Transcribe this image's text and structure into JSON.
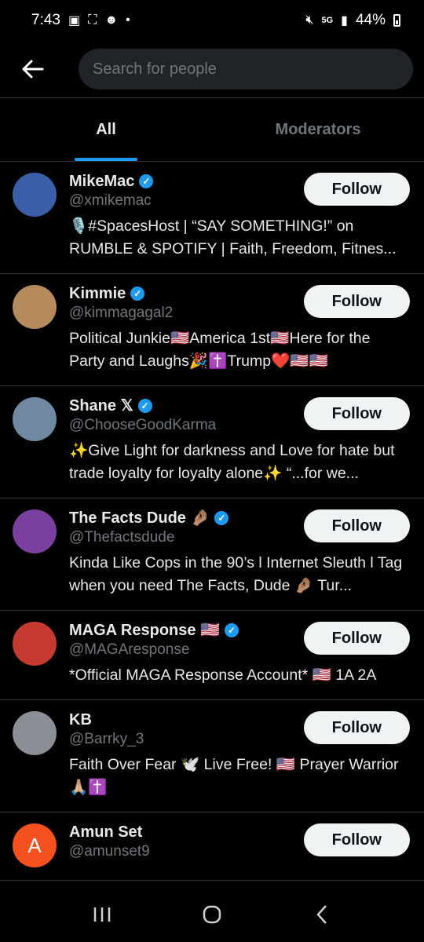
{
  "status_bar": {
    "time": "7:43",
    "battery": "44%",
    "icons": [
      "gallery-icon",
      "screenshot-icon",
      "reddit-icon",
      "dot-icon",
      "mute-icon",
      "5g-icon",
      "signal-icon",
      "battery-icon"
    ]
  },
  "header": {
    "search_placeholder": "Search for people",
    "back_icon": "arrow-left-icon"
  },
  "tabs": [
    {
      "label": "All",
      "active": true
    },
    {
      "label": "Moderators",
      "active": false
    }
  ],
  "users": [
    {
      "name": "MikeMac",
      "emoji": "",
      "verified": true,
      "handle": "@xmikemac",
      "bio": "🎙️#SpacesHost | “SAY SOMETHING!” on RUMBLE & SPOTIFY | Faith, Freedom, Fitnes...",
      "follow_label": "Follow",
      "avatar_color": "#3b5ea8",
      "avatar_letter": ""
    },
    {
      "name": "Kimmie",
      "emoji": "",
      "verified": true,
      "handle": "@kimmagagal2",
      "bio": "Political Junkie🇺🇸America 1st🇺🇸Here for the Party and Laughs🎉✝️Trump❤️🇺🇸🇺🇸",
      "follow_label": "Follow",
      "avatar_color": "#b58a5c",
      "avatar_letter": ""
    },
    {
      "name": "Shane 𝕏",
      "emoji": "",
      "verified": true,
      "handle": "@ChooseGoodKarma",
      "bio": "✨Give Light for darkness and Love for hate but trade loyalty for loyalty alone✨ “...for we...",
      "follow_label": "Follow",
      "avatar_color": "#6f8aa0",
      "avatar_letter": ""
    },
    {
      "name": "The Facts Dude 🤌🏽",
      "emoji": "",
      "verified": true,
      "handle": "@Thefactsdude",
      "bio": "Kinda Like Cops in the 90’s l Internet Sleuth l Tag when you need The Facts, Dude 🤌🏽 Tur...",
      "follow_label": "Follow",
      "avatar_color": "#7b3fa0",
      "avatar_letter": ""
    },
    {
      "name": "MAGA Response 🇺🇸",
      "emoji": "",
      "verified": true,
      "handle": "@MAGAresponse",
      "bio": "*Official MAGA Response Account* 🇺🇸 1A 2A",
      "follow_label": "Follow",
      "avatar_color": "#c43a2f",
      "avatar_letter": ""
    },
    {
      "name": "KB",
      "emoji": "",
      "verified": false,
      "handle": "@Barrky_3",
      "bio": "Faith Over Fear 🕊️ Live Free! 🇺🇸 Prayer Warrior 🙏🏼✝️",
      "follow_label": "Follow",
      "avatar_color": "#8a8f96",
      "avatar_letter": ""
    },
    {
      "name": "Amun Set",
      "emoji": "",
      "verified": false,
      "handle": "@amunset9",
      "bio": "",
      "follow_label": "Follow",
      "avatar_color": "#f4511e",
      "avatar_letter": "A"
    }
  ],
  "nav_bar": {
    "recents_icon": "|||",
    "home_icon": "◯",
    "back_icon": "〈"
  }
}
